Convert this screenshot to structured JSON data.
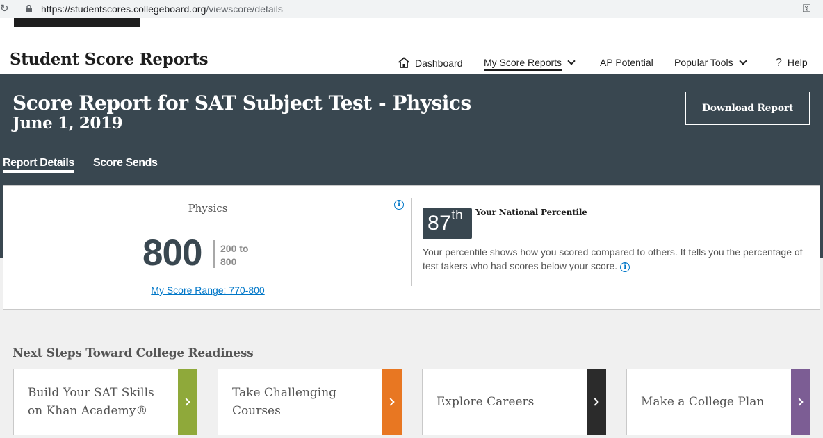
{
  "browser": {
    "url_host": "https://studentscores.collegeboard.org",
    "url_path": "/viewscore/details"
  },
  "header": {
    "site_title": "Student Score Reports",
    "nav": {
      "dashboard": "Dashboard",
      "my_score_reports": "My Score Reports",
      "ap_potential": "AP Potential",
      "popular_tools": "Popular Tools",
      "help": "Help"
    }
  },
  "banner": {
    "title": "Score Report for SAT Subject Test - Physics",
    "date": "June 1, 2019",
    "download_label": "Download Report",
    "tabs": {
      "report_details": "Report Details",
      "score_sends": "Score Sends"
    }
  },
  "score_card": {
    "subject": "Physics",
    "score": "800",
    "range_of": "200 to",
    "range_max": "800",
    "score_range_link": "My Score Range: 770-800",
    "percentile_number": "87",
    "percentile_suffix": "th",
    "percentile_label": "Your National Percentile",
    "percentile_description": "Your percentile shows how you scored compared to others. It tells you the percentage of test takers who had scores below your score."
  },
  "next_steps": {
    "title": "Next Steps Toward College Readiness",
    "tiles": [
      {
        "label": "Build Your SAT Skills on Khan Academy®",
        "color": "#8fa93a"
      },
      {
        "label": "Take Challenging Courses",
        "color": "#e87722"
      },
      {
        "label": "Explore Careers",
        "color": "#2b2b2b"
      },
      {
        "label": "Make a College Plan",
        "color": "#7c5d94"
      }
    ]
  },
  "colors": {
    "banner": "#394750",
    "link": "#0077c8"
  },
  "icons": [
    "reload-icon",
    "lock-icon",
    "key-icon",
    "home-icon",
    "chevron-down-icon",
    "help-icon",
    "info-icon",
    "chevron-right-icon"
  ]
}
